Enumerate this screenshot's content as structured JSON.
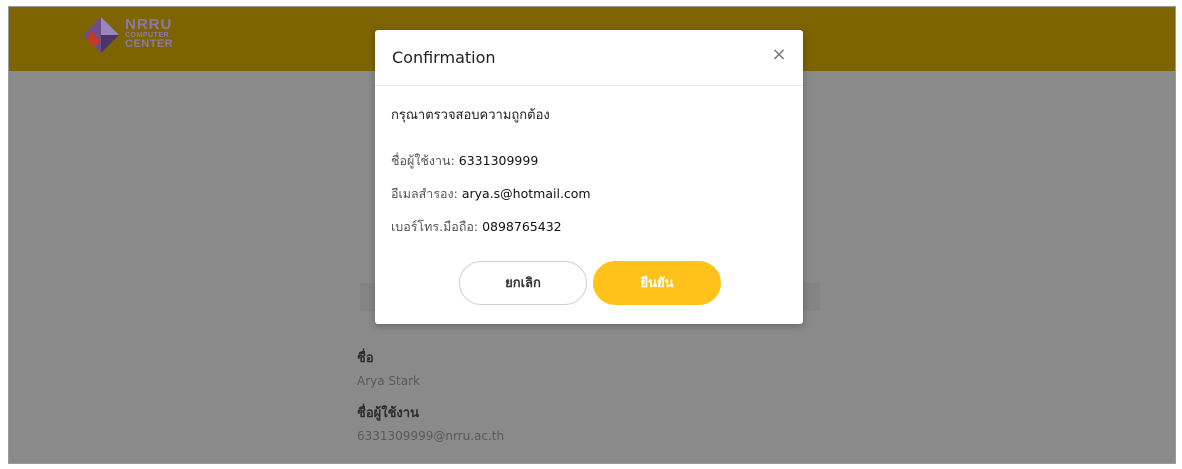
{
  "header": {
    "logo_line1": "NRRU",
    "logo_line2": "COMPUTER",
    "logo_line3": "CENTER"
  },
  "background": {
    "name_label": "ชื่อ",
    "name_value": "Arya Stark",
    "username_label": "ชื่อผู้ใช้งาน",
    "username_value": "6331309999@nrru.ac.th"
  },
  "modal": {
    "title": "Confirmation",
    "close_symbol": "×",
    "instruction": "กรุณาตรวจสอบความถูกต้อง",
    "fields": [
      {
        "label": "ชื่อผู้ใช้งาน: ",
        "value": "6331309999"
      },
      {
        "label": "อีเมลสำรอง: ",
        "value": "arya.s@hotmail.com"
      },
      {
        "label": "เบอร์โทร.มือถือ: ",
        "value": "0898765432"
      }
    ],
    "cancel_label": "ยกเลิก",
    "confirm_label": "ยืนยัน"
  },
  "colors": {
    "header": "#7e6400",
    "overlay": "#8a8a8a",
    "accent": "#ffc21a"
  }
}
